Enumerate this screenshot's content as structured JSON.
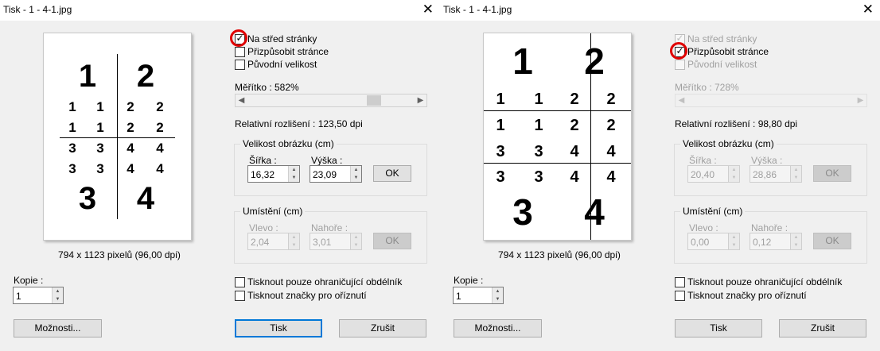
{
  "left": {
    "title": "Tisk - 1 - 4-1.jpg",
    "close_glyph": "✕",
    "preview": {
      "big": [
        "1",
        "2",
        "3",
        "4"
      ],
      "small": [
        [
          "1",
          "1",
          "2",
          "2"
        ],
        [
          "1",
          "1",
          "2",
          "2"
        ],
        [
          "3",
          "3",
          "4",
          "4"
        ],
        [
          "3",
          "3",
          "4",
          "4"
        ]
      ],
      "caption": "794 x 1123 pixelů (96,00 dpi)"
    },
    "options": {
      "center": {
        "label": "Na střed stránky",
        "checked": true
      },
      "fit": {
        "label": "Přizpůsobit stránce",
        "checked": false
      },
      "original": {
        "label": "Původní velikost",
        "checked": false
      }
    },
    "scale": {
      "label": "Měřítko : 582%",
      "position": 0.738
    },
    "resolution": "Relativní rozlišení  : 123,50 dpi",
    "size": {
      "group": "Velikost obrázku (cm)",
      "width_label": "Šířka :",
      "width": "16,32",
      "height_label": "Výška :",
      "height": "23,09",
      "ok": "OK"
    },
    "position": {
      "group": "Umístění (cm)",
      "left_label": "Vlevo :",
      "left": "2,04",
      "top_label": "Nahoře :",
      "top": "3,01",
      "ok": "OK"
    },
    "bounding": "Tisknout pouze ohraničující obdélník",
    "cropmarks": "Tisknout značky pro oříznutí",
    "copies": {
      "label": "Kopie :",
      "value": "1"
    },
    "buttons": {
      "options": "Možnosti...",
      "print": "Tisk",
      "cancel": "Zrušit"
    }
  },
  "right": {
    "title": "Tisk - 1 - 4-1.jpg",
    "close_glyph": "✕",
    "preview": {
      "big": [
        "1",
        "2",
        "3",
        "4"
      ],
      "small": [
        [
          "1",
          "1",
          "2",
          "2"
        ],
        [
          "1",
          "1",
          "2",
          "2"
        ],
        [
          "3",
          "3",
          "4",
          "4"
        ],
        [
          "3",
          "3",
          "4",
          "4"
        ]
      ],
      "caption": "794 x 1123 pixelů (96,00 dpi)"
    },
    "options": {
      "center": {
        "label": "Na střed stránky",
        "checked": true
      },
      "fit": {
        "label": "Přizpůsobit stránce",
        "checked": true
      },
      "original": {
        "label": "Původní velikost",
        "checked": false
      }
    },
    "scale": {
      "label": "Měřítko : 728%"
    },
    "resolution": "Relativní rozlišení  : 98,80 dpi",
    "size": {
      "group": "Velikost obrázku (cm)",
      "width_label": "Šířka :",
      "width": "20,40",
      "height_label": "Výška :",
      "height": "28,86",
      "ok": "OK"
    },
    "position": {
      "group": "Umístění (cm)",
      "left_label": "Vlevo :",
      "left": "0,00",
      "top_label": "Nahoře :",
      "top": "0,12",
      "ok": "OK"
    },
    "bounding": "Tisknout pouze ohraničující obdélník",
    "cropmarks": "Tisknout značky pro oříznutí",
    "copies": {
      "label": "Kopie :",
      "value": "1"
    },
    "buttons": {
      "options": "Možnosti...",
      "print": "Tisk",
      "cancel": "Zrušit"
    }
  },
  "colors": {
    "highlight_ring": "#e00000",
    "default_button_border": "#0078d7"
  }
}
